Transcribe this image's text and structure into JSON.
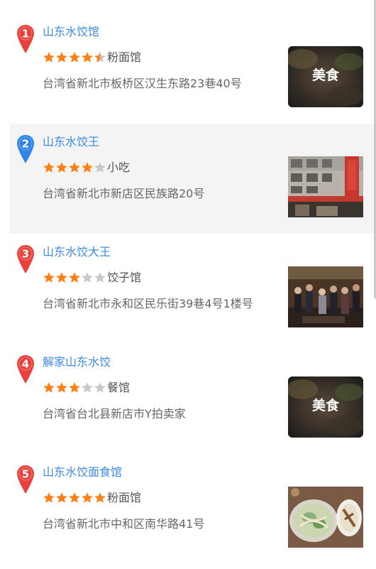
{
  "colors": {
    "link": "#3c8be3",
    "pin_red": "#e8403a",
    "pin_blue": "#2f84e4",
    "star_on": "#ff7f12",
    "star_off": "#c8c8c8"
  },
  "results": [
    {
      "index": "1",
      "name": "山东水饺馆",
      "rating": 4.5,
      "category": "粉面馆",
      "address": "台湾省新北市板桥区汉生东路23巷40号",
      "pin_color": "red",
      "thumb": {
        "kind": "placeholder",
        "text": "美食"
      },
      "highlighted": false
    },
    {
      "index": "2",
      "name": "山东水饺王",
      "rating": 4,
      "category": "小吃",
      "address": "台湾省新北市新店区民族路20号",
      "pin_color": "blue",
      "thumb": {
        "kind": "photo-storefront",
        "text": ""
      },
      "highlighted": true
    },
    {
      "index": "3",
      "name": "山东水饺大王",
      "rating": 3,
      "category": "饺子馆",
      "address": "台湾省新北市永和区民乐街39巷4号1楼号",
      "pin_color": "red",
      "thumb": {
        "kind": "photo-crowd",
        "text": ""
      },
      "highlighted": false
    },
    {
      "index": "4",
      "name": "解家山东水饺",
      "rating": 3,
      "category": "餐馆",
      "address": "台湾省台北县新店市Y拍卖家",
      "pin_color": "red",
      "thumb": {
        "kind": "placeholder",
        "text": "美食"
      },
      "highlighted": false
    },
    {
      "index": "5",
      "name": "山东水饺面食馆",
      "rating": 5,
      "category": "粉面馆",
      "address": "台湾省新北市中和区南华路41号",
      "pin_color": "red",
      "thumb": {
        "kind": "photo-food",
        "text": ""
      },
      "highlighted": false
    }
  ]
}
